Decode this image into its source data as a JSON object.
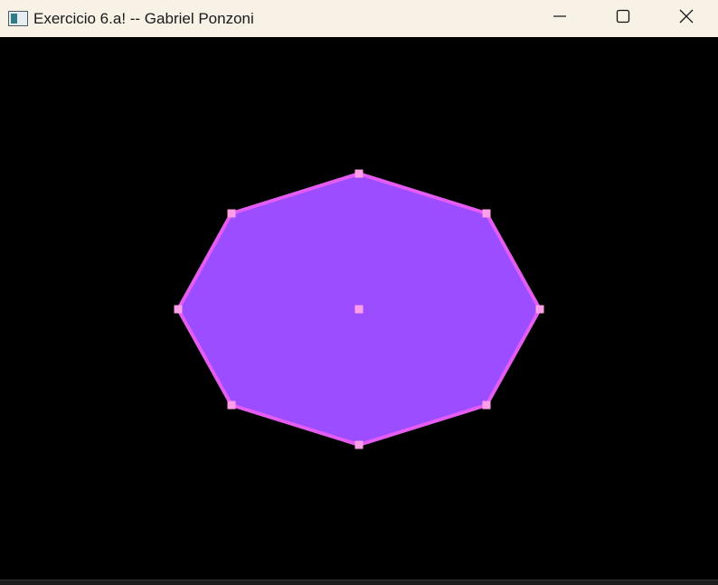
{
  "window": {
    "title": "Exercicio 6.a! -- Gabriel Ponzoni",
    "icon": "app-window-icon",
    "controls": [
      "minimize-icon",
      "maximize-icon",
      "close-icon"
    ]
  },
  "scene": {
    "background_color": "#000000",
    "polygon": {
      "shape": "octagon",
      "fill_color": "#9b4dff",
      "edge_color": "#e55cf2",
      "vertex_marker_color": "#ff9ee8",
      "center_marker_color": "#ff9ee8"
    }
  }
}
